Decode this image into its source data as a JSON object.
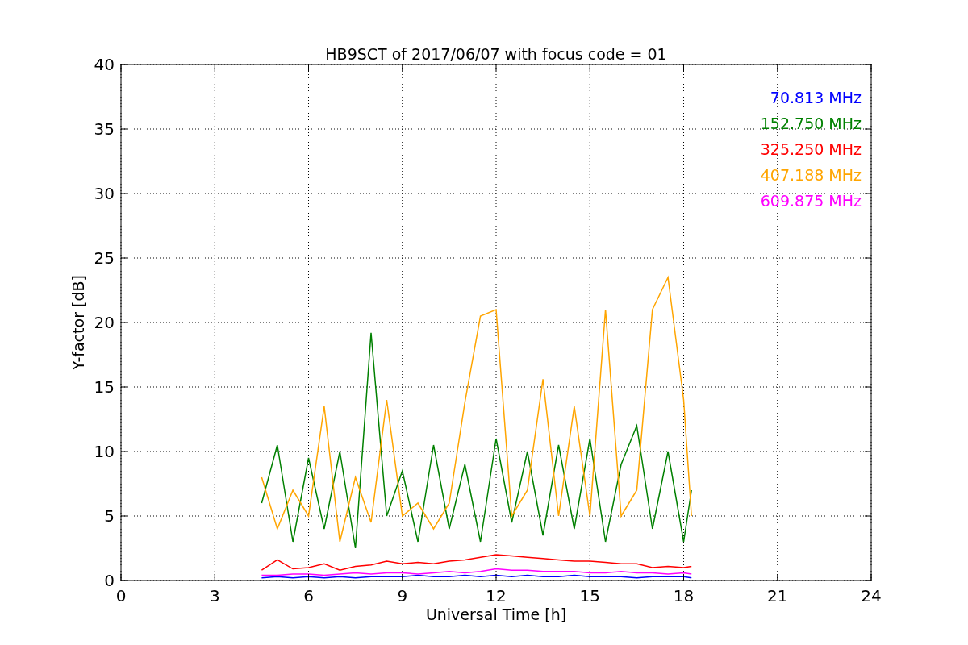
{
  "figure": {
    "chart_data": {
      "type": "line",
      "title": "HB9SCT of 2017/06/07 with focus code = 01",
      "xlabel": "Universal Time [h]",
      "ylabel": "Y-factor [dB]",
      "x": [
        4.5,
        5,
        5.5,
        6,
        6.5,
        7,
        7.5,
        8,
        8.5,
        9,
        9.5,
        10,
        10.5,
        11,
        11.5,
        12,
        12.5,
        13,
        13.5,
        14,
        14.5,
        15,
        15.5,
        16,
        16.5,
        17,
        17.5,
        18,
        18.25
      ],
      "series": [
        {
          "name": "70.813 MHz",
          "color": "#0000ff",
          "values": [
            0.2,
            0.3,
            0.2,
            0.3,
            0.2,
            0.3,
            0.2,
            0.3,
            0.3,
            0.3,
            0.4,
            0.3,
            0.3,
            0.4,
            0.3,
            0.4,
            0.3,
            0.4,
            0.3,
            0.3,
            0.4,
            0.3,
            0.3,
            0.3,
            0.2,
            0.3,
            0.3,
            0.3,
            0.2
          ]
        },
        {
          "name": "152.750 MHz",
          "color": "#008000",
          "values": [
            6,
            10.5,
            3,
            9.5,
            4,
            10,
            2.5,
            19.2,
            5,
            8.5,
            3,
            10.5,
            4,
            9,
            3,
            11,
            4.5,
            10,
            3.5,
            10.5,
            4,
            11,
            3,
            9,
            12,
            4,
            10,
            3,
            7
          ]
        },
        {
          "name": "325.250 MHz",
          "color": "#ff0000",
          "values": [
            0.8,
            1.6,
            0.9,
            1.0,
            1.3,
            0.8,
            1.1,
            1.2,
            1.5,
            1.3,
            1.4,
            1.3,
            1.5,
            1.6,
            1.8,
            2.0,
            1.9,
            1.8,
            1.7,
            1.6,
            1.5,
            1.5,
            1.4,
            1.3,
            1.3,
            1.0,
            1.1,
            1.0,
            1.1
          ]
        },
        {
          "name": "407.188 MHz",
          "color": "#ffa500",
          "values": [
            8,
            4,
            7,
            5,
            13.5,
            3,
            8,
            4.5,
            14,
            5,
            6,
            4,
            6,
            13.8,
            20.5,
            21,
            5,
            7,
            15.6,
            5,
            13.5,
            5,
            21,
            5,
            7,
            21,
            23.5,
            14,
            5
          ]
        },
        {
          "name": "609.875 MHz",
          "color": "#ff00ff",
          "values": [
            0.4,
            0.4,
            0.5,
            0.5,
            0.4,
            0.5,
            0.6,
            0.5,
            0.6,
            0.6,
            0.5,
            0.6,
            0.7,
            0.6,
            0.7,
            0.9,
            0.8,
            0.8,
            0.7,
            0.7,
            0.7,
            0.6,
            0.6,
            0.7,
            0.6,
            0.6,
            0.5,
            0.6,
            0.5
          ]
        }
      ],
      "grid": true,
      "xlim": [
        0,
        24
      ],
      "ylim": [
        0,
        40
      ],
      "xticks": [
        0,
        3,
        6,
        9,
        12,
        15,
        18,
        21,
        24
      ],
      "yticks": [
        0,
        5,
        10,
        15,
        20,
        25,
        30,
        35,
        40
      ]
    }
  }
}
